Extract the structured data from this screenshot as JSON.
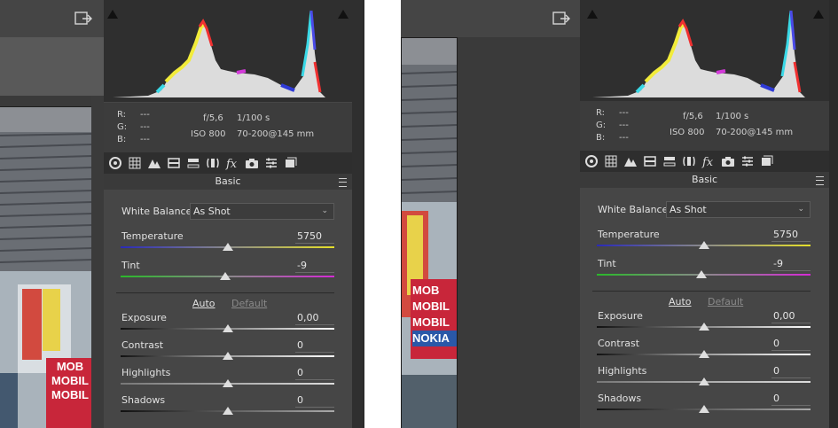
{
  "metadata": {
    "rgb_labels": [
      "R:",
      "G:",
      "B:"
    ],
    "rgb_values": [
      "---",
      "---",
      "---"
    ],
    "aperture": "f/5,6",
    "shutter": "1/100 s",
    "iso": "ISO 800",
    "lens": "70-200@145 mm"
  },
  "panel": {
    "section_title": "Basic",
    "white_balance": {
      "label": "White Balance:",
      "value": "As Shot"
    },
    "auto_label": "Auto",
    "default_label": "Default",
    "sliders": [
      {
        "label": "Temperature",
        "value": "5750",
        "position": 0.5
      },
      {
        "label": "Tint",
        "value": "-9",
        "position": 0.49
      },
      {
        "label": "Exposure",
        "value": "0,00",
        "position": 0.5
      },
      {
        "label": "Contrast",
        "value": "0",
        "position": 0.5
      },
      {
        "label": "Highlights",
        "value": "0",
        "position": 0.5
      },
      {
        "label": "Shadows",
        "value": "0",
        "position": 0.5
      }
    ]
  },
  "photo": {
    "sign_lines": [
      "MOB",
      "MOBIL",
      "MOBIL",
      "NOKIA"
    ]
  },
  "colors": {
    "panel_bg": "#464646",
    "accent_link": "#e0e0e0",
    "default_link": "#8a8a8a"
  }
}
